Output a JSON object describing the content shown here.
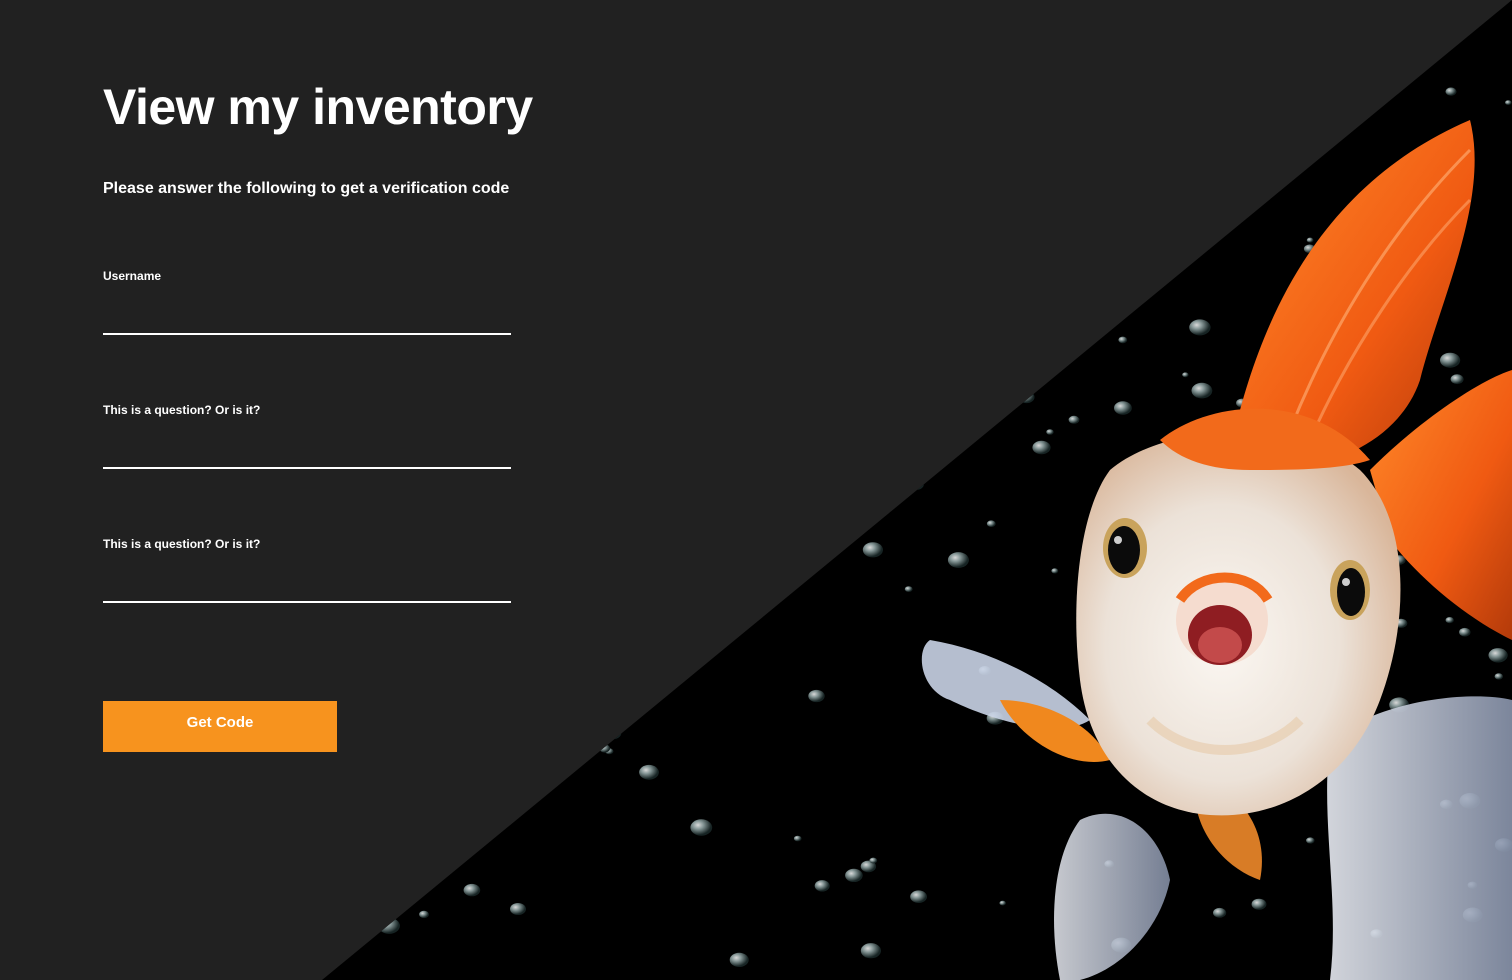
{
  "page": {
    "title": "View my inventory",
    "subtitle": "Please answer the following to get a verification code"
  },
  "form": {
    "fields": [
      {
        "label": "Username",
        "value": "",
        "placeholder": ""
      },
      {
        "label": "This is a question? Or is it?",
        "value": "",
        "placeholder": ""
      },
      {
        "label": "This is a question? Or is it?",
        "value": "",
        "placeholder": ""
      }
    ],
    "submit_label": "Get Code"
  },
  "hero_image": {
    "subject": "goldfish-with-bubbles",
    "icon": "goldfish-illustration"
  },
  "colors": {
    "background": "#212121",
    "accent": "#f7931e",
    "text": "#ffffff",
    "photo_background": "#000000",
    "fish_orange": "#f26a1b",
    "fish_white": "#f1ece6"
  }
}
